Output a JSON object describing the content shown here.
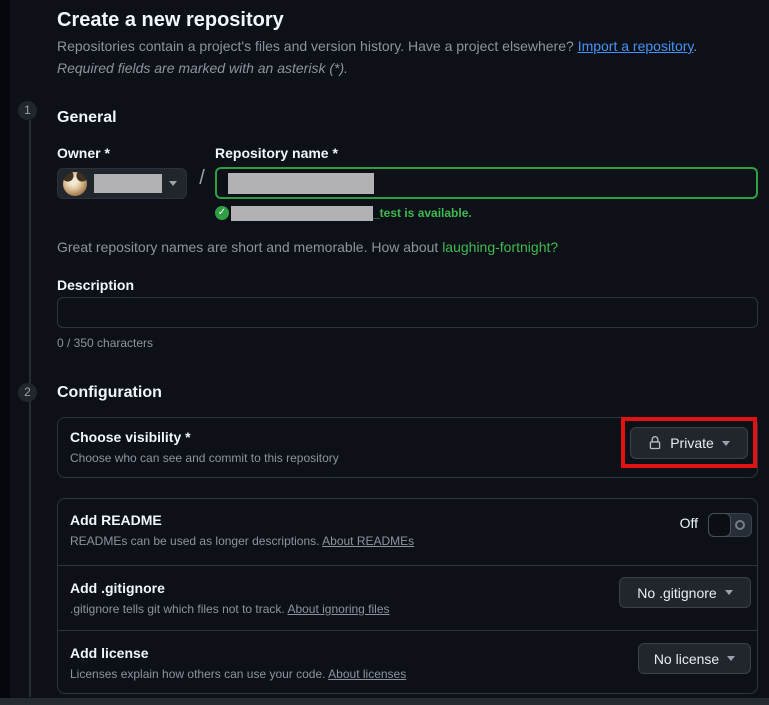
{
  "page": {
    "title": "Create a new repository",
    "subtitle_text": "Repositories contain a project's files and version history. Have a project elsewhere? ",
    "subtitle_link": "Import a repository",
    "subtitle_period": ".",
    "required_note": "Required fields are marked with an asterisk (*)."
  },
  "steps": {
    "general": {
      "number": "1",
      "title": "General"
    },
    "configuration": {
      "number": "2",
      "title": "Configuration"
    }
  },
  "general": {
    "owner_label": "Owner *",
    "separator": "/",
    "repo_name_label": "Repository name *",
    "availability_suffix": "_test is available.",
    "check_glyph": "✓",
    "suggestion_text": "Great repository names are short and memorable. How about ",
    "suggestion_link": "laughing-fortnight?",
    "description_label": "Description",
    "description_value": "",
    "description_placeholder": "",
    "char_counter": "0 / 350 characters"
  },
  "configuration": {
    "visibility": {
      "label": "Choose visibility *",
      "description": "Choose who can see and commit to this repository",
      "button_label": "Private"
    },
    "readme": {
      "label": "Add README",
      "description": "READMEs can be used as longer descriptions. ",
      "link": "About READMEs",
      "toggle_state": "Off"
    },
    "gitignore": {
      "label": "Add .gitignore",
      "description": ".gitignore tells git which files not to track. ",
      "link": "About ignoring files",
      "button_label": "No .gitignore"
    },
    "license": {
      "label": "Add license",
      "description": "Licenses explain how others can use your code. ",
      "link": "About licenses",
      "button_label": "No license"
    }
  },
  "colors": {
    "page_background": "#0d1117",
    "card_border": "#2f353d",
    "accent_green": "#3fb950",
    "input_focus_green": "#2ea043",
    "link_blue": "#4493f8",
    "annotation_red": "#e31212",
    "muted_text": "#8b949e",
    "heading_text": "#f0f6fc",
    "button_background": "#21262d",
    "redaction_gray": "#b2b1b3"
  }
}
